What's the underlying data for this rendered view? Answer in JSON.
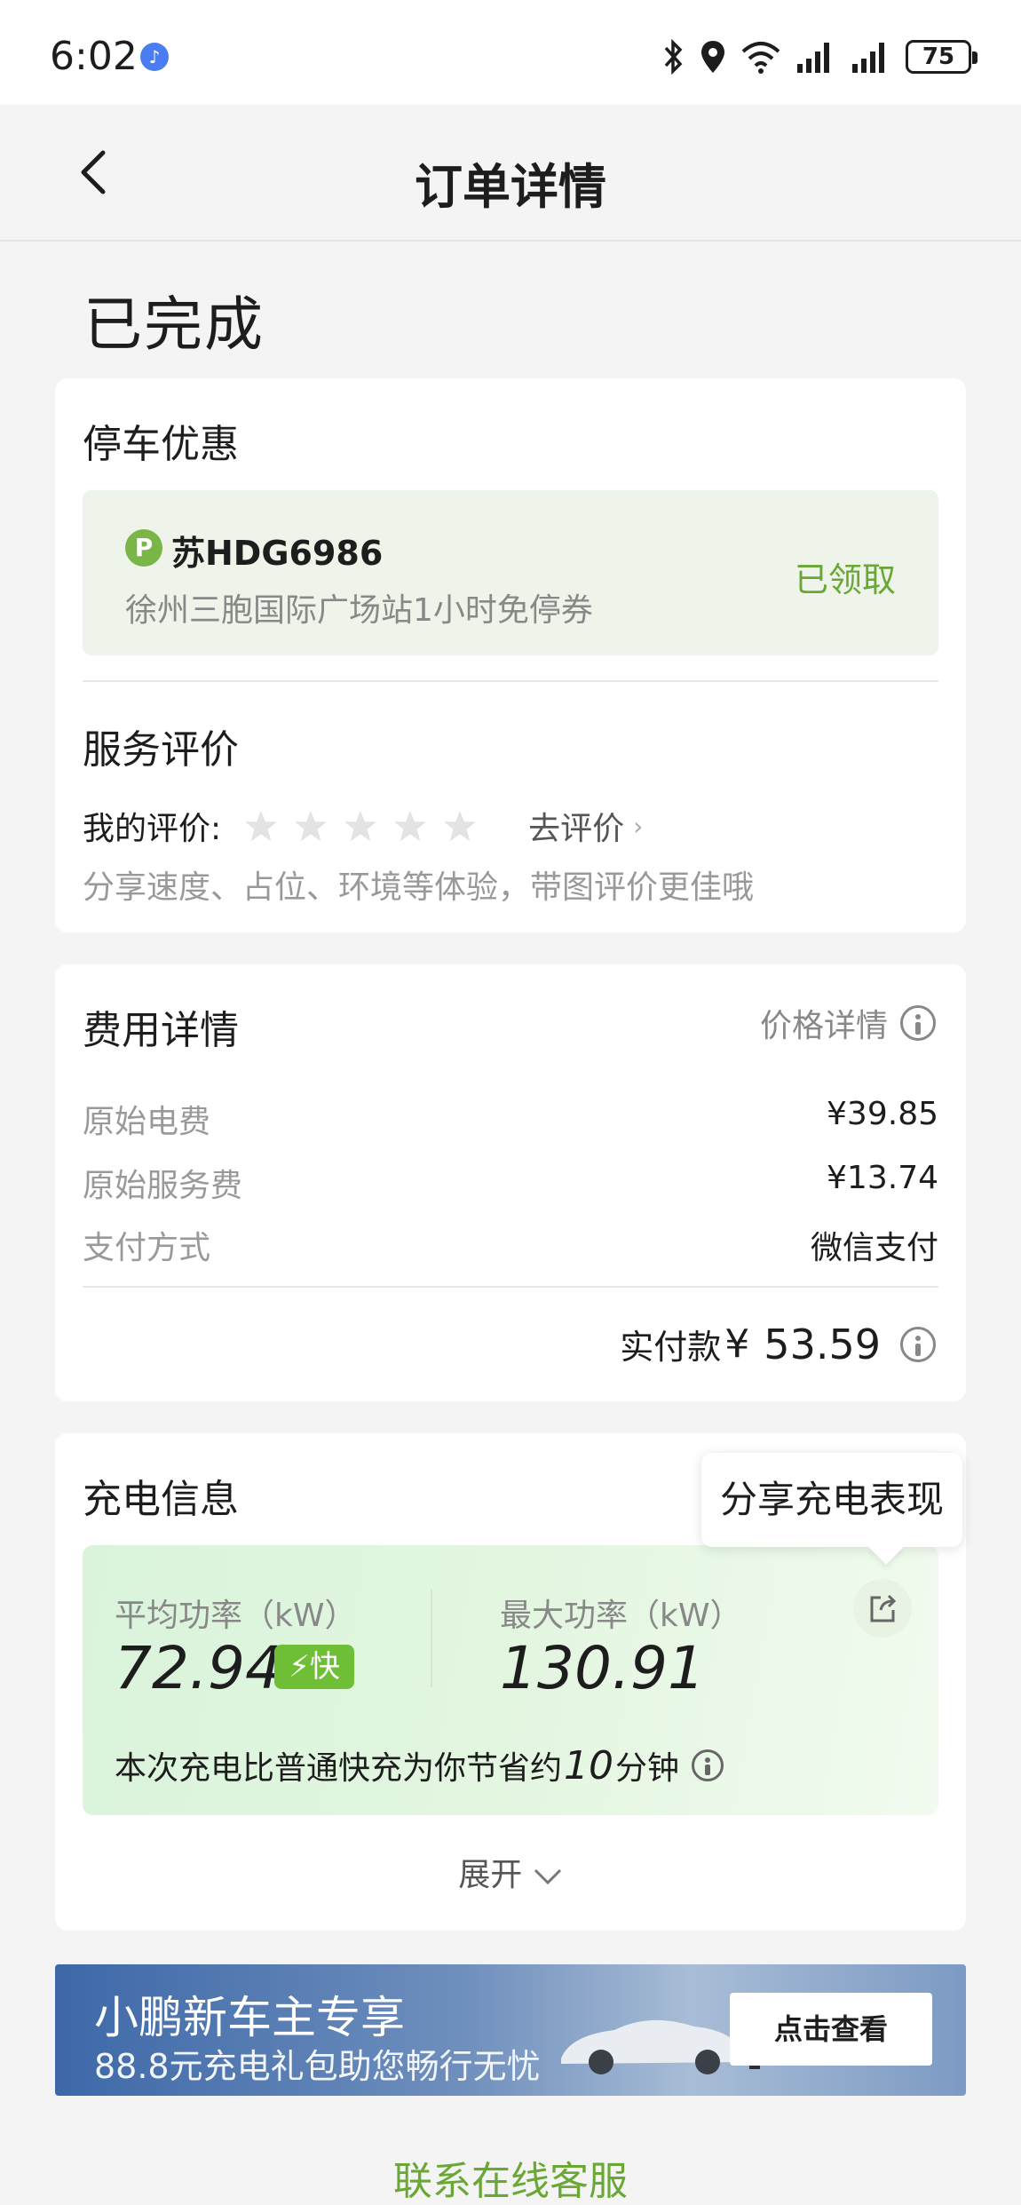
{
  "status_bar": {
    "time": "6:02",
    "battery": "75"
  },
  "nav": {
    "title": "订单详情"
  },
  "order_status": "已完成",
  "parking": {
    "title": "停车优惠",
    "badge": "P",
    "plate": "苏HDG6986",
    "description": "徐州三胞国际广场站1小时免停券",
    "status": "已领取"
  },
  "rating": {
    "title": "服务评价",
    "label": "我的评价:",
    "stars_total": 5,
    "stars_filled": 0,
    "link": "去评价",
    "hint": "分享速度、占位、环境等体验，带图评价更佳哦"
  },
  "fee": {
    "title": "费用详情",
    "detail_link": "价格详情",
    "rows": [
      {
        "label": "原始电费",
        "value": "¥39.85"
      },
      {
        "label": "原始服务费",
        "value": "¥13.74"
      },
      {
        "label": "支付方式",
        "value": "微信支付"
      }
    ],
    "total_label": "实付款",
    "total_currency": "¥",
    "total_amount": "53.59"
  },
  "charging": {
    "title": "充电信息",
    "tooltip": "分享充电表现",
    "avg_label": "平均功率（kW）",
    "avg_value": "72.94",
    "fast_badge": "⚡快",
    "max_label": "最大功率（kW）",
    "max_value": "130.91",
    "note_prefix": "本次充电比普通快充为你节省约",
    "note_num": "10",
    "note_suffix": "分钟",
    "expand": "展开"
  },
  "banner": {
    "title": "小鹏新车主专享",
    "subtitle": "88.8元充电礼包助您畅行无忧",
    "button": "点击查看"
  },
  "contact": "联系在线客服",
  "colors": {
    "accent_green": "#6aa734",
    "badge_green": "#7ab547"
  }
}
